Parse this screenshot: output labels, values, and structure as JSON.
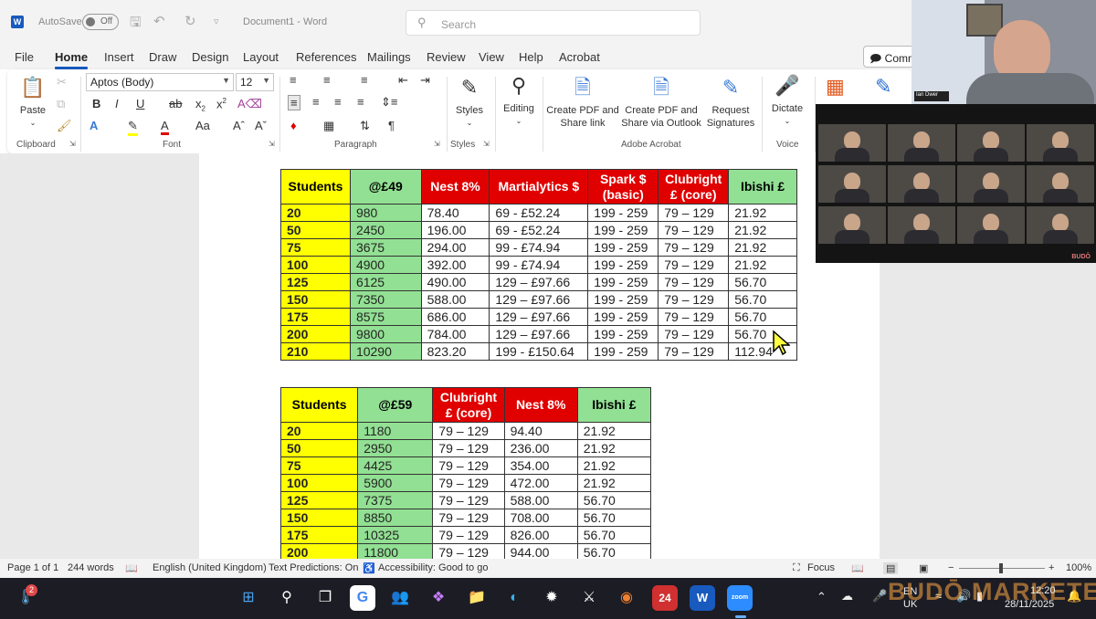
{
  "title_bar": {
    "autosave_label": "AutoSave",
    "autosave_state": "Off",
    "document_title": "Document1 - Word",
    "search_placeholder": "Search"
  },
  "menu": {
    "items": [
      "File",
      "Home",
      "Insert",
      "Draw",
      "Design",
      "Layout",
      "References",
      "Mailings",
      "Review",
      "View",
      "Help",
      "Acrobat"
    ],
    "active": "Home",
    "comments_label": "Comm"
  },
  "ribbon": {
    "clipboard": {
      "paste_label": "Paste",
      "group_label": "Clipboard"
    },
    "font": {
      "font_name": "Aptos (Body)",
      "font_size": "12",
      "group_label": "Font"
    },
    "paragraph": {
      "group_label": "Paragraph"
    },
    "styles": {
      "button_label": "Styles",
      "group_label": "Styles"
    },
    "editing": {
      "button_label": "Editing"
    },
    "acrobat": {
      "create_pdf_share_link": "Create PDF and Share link",
      "create_pdf_share_outlook": "Create PDF and Share via Outlook",
      "request_signatures": "Request Signatures",
      "group_label": "Adobe Acrobat"
    },
    "voice": {
      "dictate_label": "Dictate",
      "group_label": "Voice"
    }
  },
  "table1": {
    "headers": [
      "Students",
      "@£49",
      "Nest 8%",
      "Martialytics $",
      "Spark $ (basic)",
      "Clubright £ (core)",
      "Ibishi £"
    ],
    "rows": [
      [
        "20",
        "980",
        "78.40",
        "69 - £52.24",
        "199 - 259",
        "79 – 129",
        "21.92"
      ],
      [
        "50",
        "2450",
        "196.00",
        "69 - £52.24",
        "199 - 259",
        "79 – 129",
        "21.92"
      ],
      [
        "75",
        "3675",
        "294.00",
        "99 - £74.94",
        "199 - 259",
        "79 – 129",
        "21.92"
      ],
      [
        "100",
        "4900",
        "392.00",
        "99 - £74.94",
        "199 - 259",
        "79 – 129",
        "21.92"
      ],
      [
        "125",
        "6125",
        "490.00",
        "129 – £97.66",
        "199 - 259",
        "79 – 129",
        "56.70"
      ],
      [
        "150",
        "7350",
        "588.00",
        "129 – £97.66",
        "199 - 259",
        "79 – 129",
        "56.70"
      ],
      [
        "175",
        "8575",
        "686.00",
        "129 – £97.66",
        "199 - 259",
        "79 – 129",
        "56.70"
      ],
      [
        "200",
        "9800",
        "784.00",
        "129 – £97.66",
        "199 - 259",
        "79 – 129",
        "56.70"
      ],
      [
        "210",
        "10290",
        "823.20",
        "199 - £150.64",
        "199 - 259",
        "79 – 129",
        "112.94"
      ]
    ]
  },
  "table2": {
    "headers": [
      "Students",
      "@£59",
      "Clubright £ (core)",
      "Nest 8%",
      "Ibishi £"
    ],
    "rows": [
      [
        "20",
        "1180",
        "79 – 129",
        "94.40",
        "21.92"
      ],
      [
        "50",
        "2950",
        "79 – 129",
        "236.00",
        "21.92"
      ],
      [
        "75",
        "4425",
        "79 – 129",
        "354.00",
        "21.92"
      ],
      [
        "100",
        "5900",
        "79 – 129",
        "472.00",
        "21.92"
      ],
      [
        "125",
        "7375",
        "79 – 129",
        "588.00",
        "56.70"
      ],
      [
        "150",
        "8850",
        "79 – 129",
        "708.00",
        "56.70"
      ],
      [
        "175",
        "10325",
        "79 – 129",
        "826.00",
        "56.70"
      ],
      [
        "200",
        "11800",
        "79 – 129",
        "944.00",
        "56.70"
      ]
    ]
  },
  "status_bar": {
    "page": "Page 1 of 1",
    "words": "244 words",
    "language": "English (United Kingdom)",
    "text_predictions": "Text Predictions: On",
    "accessibility": "Accessibility: Good to go",
    "focus": "Focus",
    "zoom": "100%"
  },
  "taskbar": {
    "notification_count": "2",
    "calendar_badge": "24",
    "zoom_label": "zoom",
    "lang_top": "EN",
    "lang_bottom": "UK",
    "time": "12:20",
    "date": "28/11/2025",
    "watermark": "BUDŌ MARKETERS"
  },
  "video_overlay": {
    "speaker_tag": "Ian Dwer",
    "zoom_brand": "BUDŌ"
  },
  "colors": {
    "yellow": "#ffff00",
    "green": "#92e093",
    "red": "#e00000",
    "word_blue": "#185abd"
  }
}
